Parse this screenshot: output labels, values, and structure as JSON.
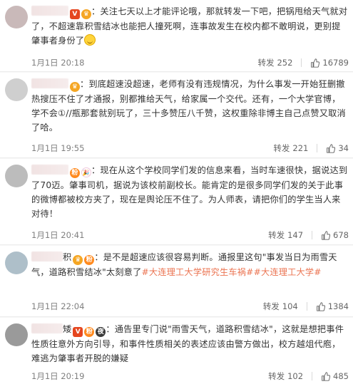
{
  "forward_label": "转发",
  "comments": [
    {
      "avatar_color": "#c9b9b9",
      "badges": [
        "v",
        "crown"
      ],
      "text": "：关注七天以上才能评论哦，那就转发一下吧，把锅甩给天气就对了，不超速靠积雪结冰也能把人撞死啊，连事故发生在校内都不敢明说，更别提肇事者身份了",
      "has_smile_emoji": true,
      "time": "1月1日 20:18",
      "forwards": "252",
      "likes": "16789"
    },
    {
      "avatar_color": "#cfcfcf",
      "badges": [
        "crown"
      ],
      "text": "：到底超速没超速，老师有没有违规情况，为什么事发一开始狂删撤热搜压不住了才通报，别都推给天气，给家属一个交代。还有，一个大学官博，学不会①//瓶那套就别玩了，三十多赞压八千赞，这权重除非博主自己点赞又取消了哈。",
      "time": "1月1日 19:55",
      "forwards": "221",
      "likes": "34"
    },
    {
      "avatar_color": "#bcbcbc",
      "badges": [
        "fan",
        "party"
      ],
      "text": "：现在从这个学校同学们发的信息来看，当时车速很快，据说达到了70迈。肇事司机，据说为该校前副校长。能肯定的是很多同学们发的关于此事的微博都被校方夹了，现在是舆论压不住了。为人师表，请把你们的学生当人来对待！",
      "time": "1月1日 20:41",
      "forwards": "147",
      "likes": "678"
    },
    {
      "avatar_color": "#aebfc9",
      "badges": [
        "crown",
        "fan"
      ],
      "name_suffix": "积",
      "text_before": "：是不是超速应该很容易判断。通报里这句\"事发当日为雨雪天气，道路积雪结冰\"太刻意了",
      "hashtag1": "#大连理工大学研究生车祸#",
      "hashtag2": "#大连理工大学#",
      "time": "1月1日 22:04",
      "forwards": "104",
      "likes": "1384"
    },
    {
      "avatar_color": "#9a9a9a",
      "badges": [
        "v",
        "fan",
        "night"
      ],
      "name_suffix": "矮",
      "text": "：通告里专门说\"雨雪天气，道路积雪结冰\"，这就是想把事件性质往意外方向引导，和事件性质相关的表述应该由警方做出，校方越俎代庖，难逃为肇事者开脱的嫌疑",
      "time": "1月1日 20:19",
      "forwards": "102",
      "likes": "485"
    }
  ]
}
